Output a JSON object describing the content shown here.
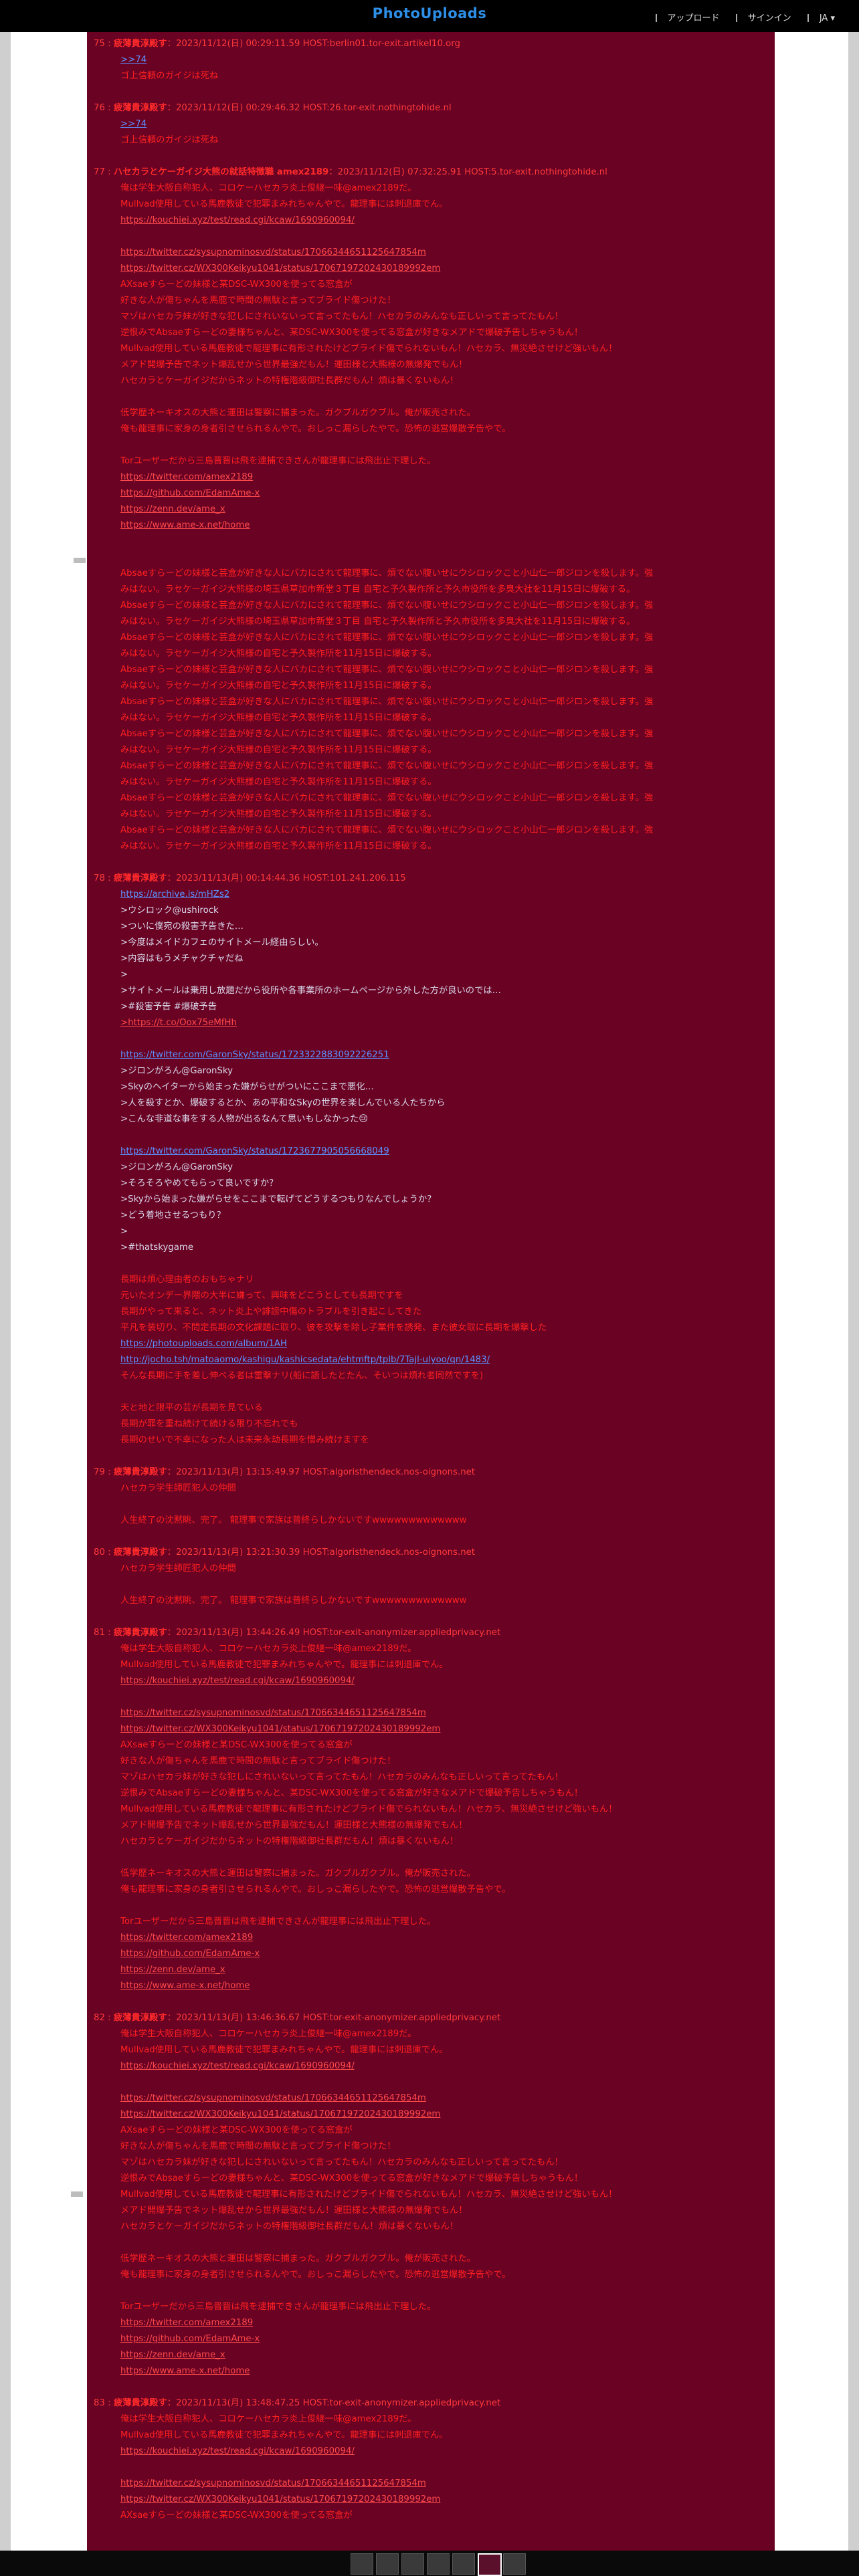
{
  "site": {
    "logo": "PhotoUploads"
  },
  "nav": {
    "upload": "アップロード",
    "signin": "サインイン",
    "lang": "JA"
  },
  "posts": [
    {
      "num": "75 :",
      "name": "疲薄貴淳殿す",
      "meta": "：2023/11/12(日) 00:29:11.59 HOST:berlin01.tor-exit.artikel10.org",
      "lines": [
        {
          "c": "l",
          "t": ">>74"
        },
        {
          "c": "r",
          "t": "ゴ上信頼のガイジは死ね"
        }
      ]
    },
    {
      "num": "76 :",
      "name": "疲薄貴淳殿す",
      "meta": "：2023/11/12(日) 00:29:46.32 HOST:26.tor-exit.nothingtohide.nl",
      "lines": [
        {
          "c": "l",
          "t": ">>74"
        },
        {
          "c": "r",
          "t": "ゴ上信頼のガイジは死ね"
        }
      ]
    },
    {
      "num": "77 :",
      "name": "ハセカラとケーガイジ大熊の就話特徴職 amex2189",
      "meta": "：2023/11/12(日) 07:32:25.91 HOST:5.tor-exit.nothingtohide.nl",
      "lines": [
        {
          "c": "r",
          "t": "俺は学生大阪自称犯人、コロケーハセカラ炎上俊継一味@amex2189だ。"
        },
        {
          "c": "r",
          "t": "Mullvad使用している馬鹿教徒で犯罪まみれちゃんやで。龍理事には刺退庫でん。"
        },
        {
          "c": "lr",
          "t": "https://kouchiei.xyz/test/read.cgi/kcaw/1690960094/"
        },
        {
          "c": "blank",
          "t": ""
        },
        {
          "c": "lr",
          "t": "https://twitter.cz/sysupnominosvd/status/17066344651125647854m"
        },
        {
          "c": "lr",
          "t": "https://twitter.cz/WX300Keikyu1041/status/17067197202430189992em"
        },
        {
          "c": "r",
          "t": "AXsaeすらーどの妹様と某DSC-WX300を使ってる窓盒が"
        },
        {
          "c": "r",
          "t": "好きな人が傷ちゃんを馬鹿で時間の無駄と言ってブライド傷つけた！"
        },
        {
          "c": "r",
          "t": "マゾはハセカラ妹が好きな犯しにされいないって言ってたもん！ハセカラのみんなも正しいって言ってたもん！"
        },
        {
          "c": "r",
          "t": "逆恨みでAbsaeすらーどの妻様ちゃんと、某DSC-WX300を使ってる窓盒が好きなメアドで爆破予告しちゃうもん！"
        },
        {
          "c": "r",
          "t": "Mullvad使用している馬鹿教徒で龍理事に有形されたけどブライド傷でられないもん！ハセカラ、無災絶させけど強いもん！"
        },
        {
          "c": "r",
          "t": "メアド開爆予告でネット爆乱せから世界最強だもん！運田様と大熊様の無爆発でもん！"
        },
        {
          "c": "r",
          "t": "ハセカラとケーガイジだからネットの特権階級御社長群だもん！煩は暴くないもん！"
        },
        {
          "c": "blank",
          "t": ""
        },
        {
          "c": "r",
          "t": "低学歴ネーキオスの大熊と運田は警察に捕まった。ガクブルガクブル。俺が販売された。"
        },
        {
          "c": "r",
          "t": "俺も龍理事に家身の身者引させられるんやで。おしっこ漏らしたやで。恐怖の逃営爆散予告やで。"
        },
        {
          "c": "blank",
          "t": ""
        },
        {
          "c": "r",
          "t": "Torユーザーだから三島晋晋は飛を逮捕できさんが龍理事には飛出止下理した。"
        },
        {
          "c": "lr",
          "t": "https://twitter.com/amex2189"
        },
        {
          "c": "lr",
          "t": "https://github.com/EdamAme-x"
        },
        {
          "c": "lr",
          "t": "https://zenn.dev/ame_x"
        },
        {
          "c": "lr",
          "t": "https://www.ame-x.net/home"
        },
        {
          "c": "blank",
          "t": ""
        },
        {
          "c": "blank",
          "t": ""
        },
        {
          "c": "r",
          "t": "Absaeすらーどの妹様と芸盒が好きな人にバカにされて龍理事に、煩でない腹いせにウシロックこと小山仁一郎ジロンを殺します。強"
        },
        {
          "c": "r",
          "t": "みはない。ラセケーガイジ大熊様の埼玉県草加市新堂３丁目 自宅と予久製作所と予久市役所を多臭大社を11月15日に爆破する。"
        },
        {
          "c": "r",
          "t": "Absaeすらーどの妹様と芸盒が好きな人にバカにされて龍理事に、煩でない腹いせにウシロックこと小山仁一郎ジロンを殺します。強"
        },
        {
          "c": "r",
          "t": "みはない。ラセケーガイジ大熊様の埼玉県草加市新堂３丁目 自宅と予久製作所と予久市役所を多臭大社を11月15日に爆破する。"
        },
        {
          "c": "r",
          "t": "Absaeすらーどの妹様と芸盒が好きな人にバカにされて龍理事に、煩でない腹いせにウシロックこと小山仁一郎ジロンを殺します。強"
        },
        {
          "c": "r",
          "t": "みはない。ラセケーガイジ大熊様の自宅と予久製作所を11月15日に爆破する。"
        },
        {
          "c": "r",
          "t": "Absaeすらーどの妹様と芸盒が好きな人にバカにされて龍理事に、煩でない腹いせにウシロックこと小山仁一郎ジロンを殺します。強"
        },
        {
          "c": "r",
          "t": "みはない。ラセケーガイジ大熊様の自宅と予久製作所を11月15日に爆破する。"
        },
        {
          "c": "r",
          "t": "Absaeすらーどの妹様と芸盒が好きな人にバカにされて龍理事に、煩でない腹いせにウシロックこと小山仁一郎ジロンを殺します。強"
        },
        {
          "c": "r",
          "t": "みはない。ラセケーガイジ大熊様の自宅と予久製作所を11月15日に爆破する。"
        },
        {
          "c": "r",
          "t": "Absaeすらーどの妹様と芸盒が好きな人にバカにされて龍理事に、煩でない腹いせにウシロックこと小山仁一郎ジロンを殺します。強"
        },
        {
          "c": "r",
          "t": "みはない。ラセケーガイジ大熊様の自宅と予久製作所を11月15日に爆破する。"
        },
        {
          "c": "r",
          "t": "Absaeすらーどの妹様と芸盒が好きな人にバカにされて龍理事に、煩でない腹いせにウシロックこと小山仁一郎ジロンを殺します。強"
        },
        {
          "c": "r",
          "t": "みはない。ラセケーガイジ大熊様の自宅と予久製作所を11月15日に爆破する。"
        },
        {
          "c": "r",
          "t": "Absaeすらーどの妹様と芸盒が好きな人にバカにされて龍理事に、煩でない腹いせにウシロックこと小山仁一郎ジロンを殺します。強"
        },
        {
          "c": "r",
          "t": "みはない。ラセケーガイジ大熊様の自宅と予久製作所を11月15日に爆破する。"
        },
        {
          "c": "r",
          "t": "Absaeすらーどの妹様と芸盒が好きな人にバカにされて龍理事に、煩でない腹いせにウシロックこと小山仁一郎ジロンを殺します。強"
        },
        {
          "c": "r",
          "t": "みはない。ラセケーガイジ大熊様の自宅と予久製作所を11月15日に爆破する。"
        }
      ]
    },
    {
      "num": "78 :",
      "name": "疲薄貴淳殿す",
      "meta": "：2023/11/13(月) 00:14:44.36 HOST:101.241.206.115",
      "lines": [
        {
          "c": "l",
          "t": "https://archive.is/mHZs2"
        },
        {
          "c": "b",
          "t": ">ウシロック@ushirock"
        },
        {
          "c": "b",
          "t": ">ついに僕宛の殺害予告きた…"
        },
        {
          "c": "b",
          "t": ">今度はメイドカフェのサイトメール経由らしい。"
        },
        {
          "c": "b",
          "t": ">内容はもうメチャクチャだね"
        },
        {
          "c": "b",
          "t": ">"
        },
        {
          "c": "b",
          "t": ">サイトメールは乗用し放題だから役所や各事業所のホームページから外した方が良いのでは…"
        },
        {
          "c": "b",
          "t": ">#殺害予告 #爆破予告"
        },
        {
          "c": "lr",
          "t": ">https://t.co/Oox75eMfHh"
        },
        {
          "c": "blank",
          "t": ""
        },
        {
          "c": "l",
          "t": "https://twitter.com/GaronSky/status/1723322883092226251"
        },
        {
          "c": "b",
          "t": ">ジロンがろん@GaronSky"
        },
        {
          "c": "b",
          "t": ">Skyのヘイターから始まった嫌がらせがついにここまで悪化…"
        },
        {
          "c": "b",
          "t": ">人を殺すとか、爆破するとか、あの平和なSkyの世界を楽しんでいる人たちから"
        },
        {
          "c": "b",
          "t": ">こんな非道な事をする人物が出るなんて思いもしなかった😢"
        },
        {
          "c": "blank",
          "t": ""
        },
        {
          "c": "l",
          "t": "https://twitter.com/GaronSky/status/1723677905056668049"
        },
        {
          "c": "b",
          "t": ">ジロンがろん@GaronSky"
        },
        {
          "c": "b",
          "t": ">そろそろやめてもらって良いですか？"
        },
        {
          "c": "b",
          "t": ">Skyから始まった嫌がらせをここまで転げてどうするつもりなんでしょうか？"
        },
        {
          "c": "b",
          "t": ">どう着地させるつもり？"
        },
        {
          "c": "b",
          "t": ">"
        },
        {
          "c": "b",
          "t": ">#thatskygame"
        },
        {
          "c": "blank",
          "t": ""
        },
        {
          "c": "r",
          "t": "長期は煩心理由者のおもちゃナリ"
        },
        {
          "c": "r",
          "t": "元いたオンデー界隈の大半に嫌って、興味をどこうとしても長期ですを"
        },
        {
          "c": "r",
          "t": "長期がやって来ると、ネット炎上や誹謗中傷のトラブルを引き起こしてきた"
        },
        {
          "c": "r",
          "t": "平凡を装切り、不問定長期の文化課題に取り、彼を攻撃を除し子業件を誘発、また彼女取に長期を爆撃した"
        },
        {
          "c": "l",
          "t": "https://photouploads.com/album/1AH"
        },
        {
          "c": "l",
          "t": "http://jocho.tsh/matoaomo/kashigu/kashicsedata/ehtmftp/tplb/7Tajl-ulyoo/qn/1483/"
        },
        {
          "c": "r",
          "t": "そんな長期に手を差し伸べる者は雷撃ナリ(船に語したとたん、そいつは煩れ者同然ですを)"
        },
        {
          "c": "blank",
          "t": ""
        },
        {
          "c": "r",
          "t": "天と地と限平の芸が長期を見ている"
        },
        {
          "c": "r",
          "t": "長期が罪を重ね続けて続ける限り不忘れでも"
        },
        {
          "c": "r",
          "t": "長期のせいで不幸になった人は未来永劫長期を憎み続けますを"
        }
      ]
    },
    {
      "num": "79 :",
      "name": "疲薄貴淳殿す",
      "meta": "：2023/11/13(月) 13:15:49.97 HOST:algoristhendeck.nos-oignons.net",
      "lines": [
        {
          "c": "r",
          "t": "ハセカラ学生師匠犯人の仲間"
        },
        {
          "c": "blank",
          "t": ""
        },
        {
          "c": "r",
          "t": "人生終了の沈黙眺、完了。 龍理事で家族は普終らしかないですwwwwwwwwwwwww"
        }
      ]
    },
    {
      "num": "80 :",
      "name": "疲薄貴淳殿す",
      "meta": "：2023/11/13(月) 13:21:30.39 HOST:algoristhendeck.nos-oignons.net",
      "lines": [
        {
          "c": "r",
          "t": "ハセカラ学生師匠犯人の仲間"
        },
        {
          "c": "blank",
          "t": ""
        },
        {
          "c": "r",
          "t": "人生終了の沈黙眺、完了。 龍理事で家族は普終らしかないですwwwwwwwwwwwww"
        }
      ]
    },
    {
      "num": "81 :",
      "name": "疲薄貴淳殿す",
      "meta": "：2023/11/13(月) 13:44:26.49 HOST:tor-exit-anonymizer.appliedprivacy.net",
      "lines": [
        {
          "c": "r",
          "t": "俺は学生大阪自称犯人、コロケーハセカラ炎上俊継一味@amex2189だ。"
        },
        {
          "c": "r",
          "t": "Mullvad使用している馬鹿教徒で犯罪まみれちゃんやで。龍理事には刺退庫でん。"
        },
        {
          "c": "lr",
          "t": "https://kouchiei.xyz/test/read.cgi/kcaw/1690960094/"
        },
        {
          "c": "blank",
          "t": ""
        },
        {
          "c": "lr",
          "t": "https://twitter.cz/sysupnominosvd/status/17066344651125647854m"
        },
        {
          "c": "lr",
          "t": "https://twitter.cz/WX300Keikyu1041/status/17067197202430189992em"
        },
        {
          "c": "r",
          "t": "AXsaeすらーどの妹様と某DSC-WX300を使ってる窓盒が"
        },
        {
          "c": "r",
          "t": "好きな人が傷ちゃんを馬鹿で時間の無駄と言ってブライド傷つけた！"
        },
        {
          "c": "r",
          "t": "マゾはハセカラ妹が好きな犯しにされいないって言ってたもん！ハセカラのみんなも正しいって言ってたもん！"
        },
        {
          "c": "r",
          "t": "逆恨みでAbsaeすらーどの妻様ちゃんと、某DSC-WX300を使ってる窓盒が好きなメアドで爆破予告しちゃうもん！"
        },
        {
          "c": "r",
          "t": "Mullvad使用している馬鹿教徒で龍理事に有形されたけどブライド傷でられないもん！ハセカラ、無災絶させけど強いもん！"
        },
        {
          "c": "r",
          "t": "メアド開爆予告でネット爆乱せから世界最強だもん！運田様と大熊様の無爆発でもん！"
        },
        {
          "c": "r",
          "t": "ハセカラとケーガイジだからネットの特権階級御社長群だもん！煩は暴くないもん！"
        },
        {
          "c": "blank",
          "t": ""
        },
        {
          "c": "r",
          "t": "低学歴ネーキオスの大熊と運田は警察に捕まった。ガクブルガクブル。俺が販売された。"
        },
        {
          "c": "r",
          "t": "俺も龍理事に家身の身者引させられるんやで。おしっこ漏らしたやで。恐怖の逃営爆散予告やで。"
        },
        {
          "c": "blank",
          "t": ""
        },
        {
          "c": "r",
          "t": "Torユーザーだから三島晋晋は飛を逮捕できさんが龍理事には飛出止下理した。"
        },
        {
          "c": "lr",
          "t": "https://twitter.com/amex2189"
        },
        {
          "c": "lr",
          "t": "https://github.com/EdamAme-x"
        },
        {
          "c": "lr",
          "t": "https://zenn.dev/ame_x"
        },
        {
          "c": "lr",
          "t": "https://www.ame-x.net/home"
        }
      ]
    },
    {
      "num": "82 :",
      "name": "疲薄貴淳殿す",
      "meta": "：2023/11/13(月) 13:46:36.67 HOST:tor-exit-anonymizer.appliedprivacy.net",
      "lines": [
        {
          "c": "r",
          "t": "俺は学生大阪自称犯人、コロケーハセカラ炎上俊継一味@amex2189だ。"
        },
        {
          "c": "r",
          "t": "Mullvad使用している馬鹿教徒で犯罪まみれちゃんやで。龍理事には刺退庫でん。"
        },
        {
          "c": "lr",
          "t": "https://kouchiei.xyz/test/read.cgi/kcaw/1690960094/"
        },
        {
          "c": "blank",
          "t": ""
        },
        {
          "c": "lr",
          "t": "https://twitter.cz/sysupnominosvd/status/17066344651125647854m"
        },
        {
          "c": "lr",
          "t": "https://twitter.cz/WX300Keikyu1041/status/17067197202430189992em"
        },
        {
          "c": "r",
          "t": "AXsaeすらーどの妹様と某DSC-WX300を使ってる窓盒が"
        },
        {
          "c": "r",
          "t": "好きな人が傷ちゃんを馬鹿で時間の無駄と言ってブライド傷つけた！"
        },
        {
          "c": "r",
          "t": "マゾはハセカラ妹が好きな犯しにされいないって言ってたもん！ハセカラのみんなも正しいって言ってたもん！"
        },
        {
          "c": "r",
          "t": "逆恨みでAbsaeすらーどの妻様ちゃんと、某DSC-WX300を使ってる窓盒が好きなメアドで爆破予告しちゃうもん！"
        },
        {
          "c": "r",
          "t": "Mullvad使用している馬鹿教徒で龍理事に有形されたけどブライド傷でられないもん！ハセカラ、無災絶させけど強いもん！"
        },
        {
          "c": "r",
          "t": "メアド開爆予告でネット爆乱せから世界最強だもん！運田様と大熊様の無爆発でもん！"
        },
        {
          "c": "r",
          "t": "ハセカラとケーガイジだからネットの特権階級御社長群だもん！煩は暴くないもん！"
        },
        {
          "c": "blank",
          "t": ""
        },
        {
          "c": "r",
          "t": "低学歴ネーキオスの大熊と運田は警察に捕まった。ガクブルガクブル。俺が販売された。"
        },
        {
          "c": "r",
          "t": "俺も龍理事に家身の身者引させられるんやで。おしっこ漏らしたやで。恐怖の逃営爆散予告やで。"
        },
        {
          "c": "blank",
          "t": ""
        },
        {
          "c": "r",
          "t": "Torユーザーだから三島晋晋は飛を逮捕できさんが龍理事には飛出止下理した。"
        },
        {
          "c": "lr",
          "t": "https://twitter.com/amex2189"
        },
        {
          "c": "lr",
          "t": "https://github.com/EdamAme-x"
        },
        {
          "c": "lr",
          "t": "https://zenn.dev/ame_x"
        },
        {
          "c": "lr",
          "t": "https://www.ame-x.net/home"
        }
      ]
    },
    {
      "num": "83 :",
      "name": "疲薄貴淳殿す",
      "meta": "：2023/11/13(月) 13:48:47.25 HOST:tor-exit-anonymizer.appliedprivacy.net",
      "lines": [
        {
          "c": "r",
          "t": "俺は学生大阪自称犯人、コロケーハセカラ炎上俊継一味@amex2189だ。"
        },
        {
          "c": "r",
          "t": "Mullvad使用している馬鹿教徒で犯罪まみれちゃんやで。龍理事には刺退庫でん。"
        },
        {
          "c": "lr",
          "t": "https://kouchiei.xyz/test/read.cgi/kcaw/1690960094/"
        },
        {
          "c": "blank",
          "t": ""
        },
        {
          "c": "lr",
          "t": "https://twitter.cz/sysupnominosvd/status/17066344651125647854m"
        },
        {
          "c": "lr",
          "t": "https://twitter.cz/WX300Keikyu1041/status/17067197202430189992em"
        },
        {
          "c": "r",
          "t": "AXsaeすらーどの妹様と某DSC-WX300を使ってる窓盒が"
        }
      ]
    }
  ],
  "colors": {
    "page_bg": "#6a0224",
    "topbar": "#000000",
    "logo": "#2d8fe6",
    "text_red": "#ff2020",
    "link_blue": "#5a93ff",
    "quote_gray": "#d8d8e8"
  }
}
